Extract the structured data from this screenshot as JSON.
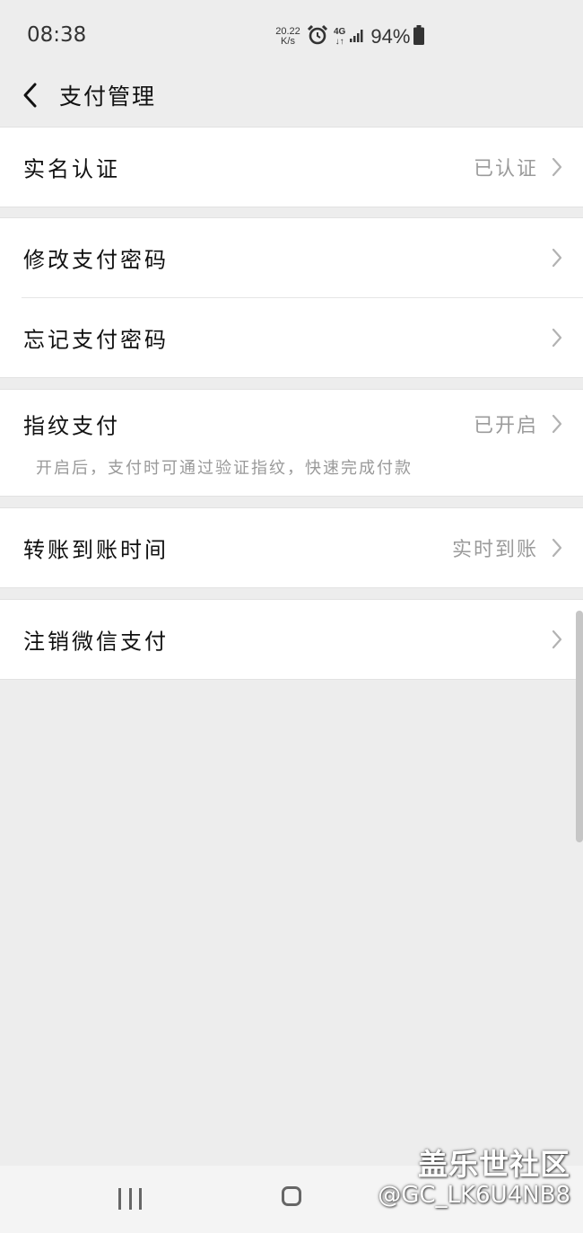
{
  "status_bar": {
    "time": "08:38",
    "net_speed_value": "20.22",
    "net_speed_unit": "K/s",
    "network_type": "4G",
    "network_arrows": "↓↑",
    "battery": "94%",
    "icons": [
      "alarm-icon",
      "signal-icon",
      "battery-icon"
    ]
  },
  "header": {
    "back_icon": "chevron-left-icon",
    "title": "支付管理"
  },
  "groups": [
    {
      "rows": [
        {
          "label": "实名认证",
          "value": "已认证"
        }
      ]
    },
    {
      "rows": [
        {
          "label": "修改支付密码",
          "value": ""
        },
        {
          "label": "忘记支付密码",
          "value": ""
        }
      ]
    },
    {
      "rows": [
        {
          "label": "指纹支付",
          "value": "已开启",
          "description": "开启后，支付时可通过验证指纹，快速完成付款"
        }
      ]
    },
    {
      "rows": [
        {
          "label": "转账到账时间",
          "value": "实时到账"
        }
      ]
    },
    {
      "rows": [
        {
          "label": "注销微信支付",
          "value": ""
        }
      ]
    }
  ],
  "watermark": {
    "brand": "盖乐世社区",
    "user": "@GC_LK6U4NB8"
  },
  "colors": {
    "background": "#ededed",
    "card": "#ffffff",
    "secondary_text": "#9b9b9b",
    "chevron": "#b2b2b2"
  }
}
